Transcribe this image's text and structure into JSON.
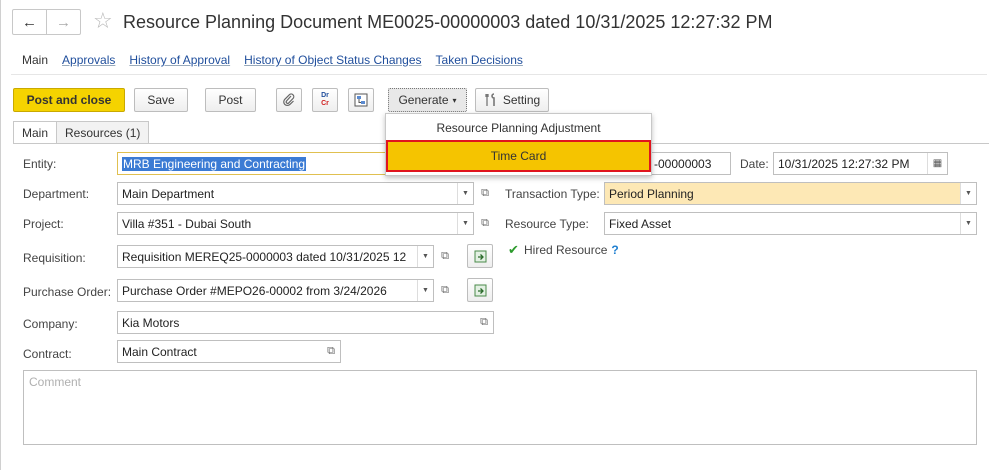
{
  "window": {
    "title": "Resource Planning Document ME0025-00000003 dated 10/31/2025 12:27:32 PM",
    "back_glyph": "←",
    "forward_glyph": "→",
    "star_glyph": "☆"
  },
  "nav": {
    "main": "Main",
    "approvals": "Approvals",
    "history_approval": "History of Approval",
    "history_status": "History of Object Status Changes",
    "taken_decisions": "Taken Decisions"
  },
  "toolbar": {
    "post_close": "Post and close",
    "save": "Save",
    "post": "Post",
    "generate": "Generate",
    "generate_arrow": "▾",
    "setting": "Setting",
    "drcr_top": "Dr",
    "drcr_bottom": "Cr"
  },
  "tabs": {
    "main": "Main",
    "resources": "Resources (1)"
  },
  "menu": {
    "items": [
      "Resource Planning Adjustment",
      "Time Card"
    ]
  },
  "form": {
    "entity": {
      "label": "Entity:",
      "value": "MRB Engineering and Contracting"
    },
    "department": {
      "label": "Department:",
      "value": "Main Department"
    },
    "project": {
      "label": "Project:",
      "value": "Villa #351 - Dubai South"
    },
    "requisition": {
      "label": "Requisition:",
      "value": "Requisition MEREQ25-0000003 dated 10/31/2025 12"
    },
    "purchase_order": {
      "label": "Purchase Order:",
      "value": "Purchase Order #MEPO26-00002 from 3/24/2026"
    },
    "company": {
      "label": "Company:",
      "value": "Kia Motors"
    },
    "contract": {
      "label": "Contract:",
      "value": "Main Contract"
    },
    "number_partial": "-00000003",
    "date": {
      "label": "Date:",
      "value": "10/31/2025 12:27:32 PM"
    },
    "transaction_type": {
      "label": "Transaction Type:",
      "value": "Period Planning"
    },
    "resource_type": {
      "label": "Resource Type:",
      "value": "Fixed Asset"
    },
    "hired_resource": {
      "label": "Hired Resource",
      "help": "?",
      "checked": true
    },
    "comment_placeholder": "Comment"
  },
  "colors": {
    "primary_button": "#f5d300",
    "menu_highlight": "#f5c400",
    "menu_highlight_border": "#e0141e",
    "selection": "#3b7bd4",
    "highlight_field": "#fde8b5",
    "link": "#1f4e9c"
  }
}
